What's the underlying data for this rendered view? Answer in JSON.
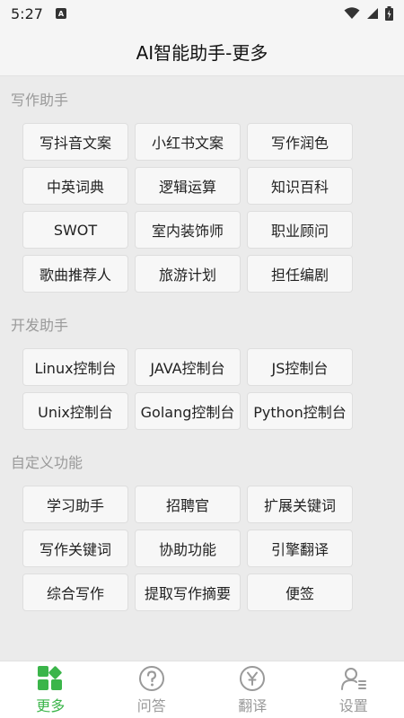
{
  "status_bar": {
    "time": "5:27",
    "badge": "A"
  },
  "header": {
    "title": "AI智能助手-更多"
  },
  "sections": [
    {
      "title": "写作助手",
      "items": [
        "写抖音文案",
        "小红书文案",
        "写作润色",
        "中英词典",
        "逻辑运算",
        "知识百科",
        "SWOT",
        "室内装饰师",
        "职业顾问",
        "歌曲推荐人",
        "旅游计划",
        "担任编剧"
      ]
    },
    {
      "title": "开发助手",
      "items": [
        "Linux控制台",
        "JAVA控制台",
        "JS控制台",
        "Unix控制台",
        "Golang控制台",
        "Python控制台"
      ]
    },
    {
      "title": "自定义功能",
      "items": [
        "学习助手",
        "招聘官",
        "扩展关键词",
        "写作关键词",
        "协助功能",
        "引擎翻译",
        "综合写作",
        "提取写作摘要",
        "便签"
      ]
    }
  ],
  "tabs": [
    {
      "label": "更多",
      "icon": "more-grid-icon",
      "active": true
    },
    {
      "label": "问答",
      "icon": "question-icon",
      "active": false
    },
    {
      "label": "翻译",
      "icon": "translate-icon",
      "active": false
    },
    {
      "label": "设置",
      "icon": "settings-user-icon",
      "active": false
    }
  ],
  "colors": {
    "accent": "#3bb54a",
    "inactive": "#9a9a9a"
  }
}
